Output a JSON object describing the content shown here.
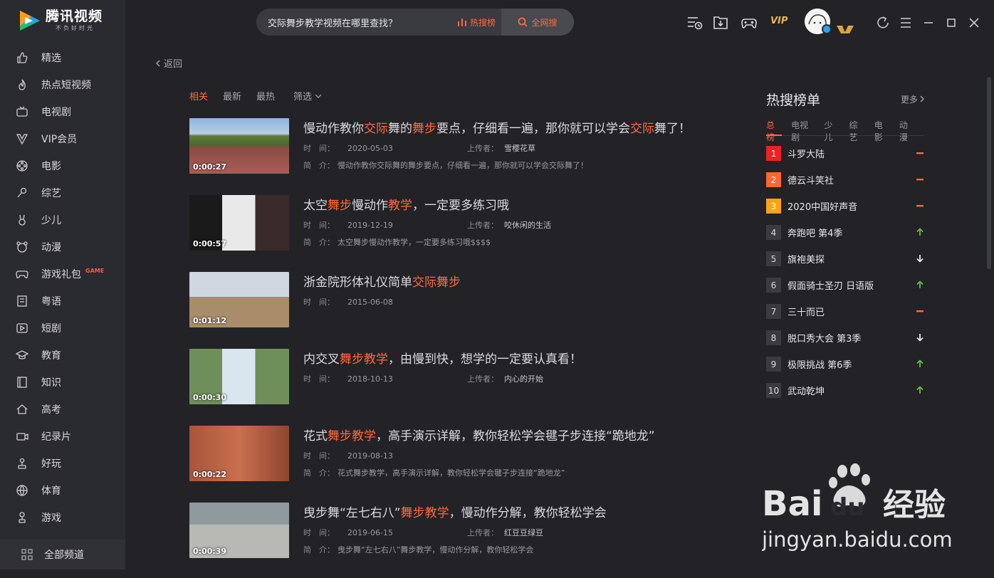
{
  "app": {
    "title": "腾讯视频",
    "slogan": "不负好时光"
  },
  "sidebar": {
    "items": [
      {
        "label": "精选",
        "icon": "thumbs-up-icon"
      },
      {
        "label": "热点短视频",
        "icon": "flame-icon"
      },
      {
        "label": "电视剧",
        "icon": "tv-icon"
      },
      {
        "label": "VIP会员",
        "icon": "vip-crown-icon"
      },
      {
        "label": "电影",
        "icon": "film-reel-icon"
      },
      {
        "label": "综艺",
        "icon": "microphone-icon"
      },
      {
        "label": "少儿",
        "icon": "bunny-icon"
      },
      {
        "label": "动漫",
        "icon": "bear-icon"
      },
      {
        "label": "游戏礼包",
        "icon": "gamepad-icon",
        "badge": "GAME"
      },
      {
        "label": "粤语",
        "icon": "document-icon"
      },
      {
        "label": "短剧",
        "icon": "play-square-icon"
      },
      {
        "label": "教育",
        "icon": "graduation-cap-icon"
      },
      {
        "label": "知识",
        "icon": "book-icon"
      },
      {
        "label": "高考",
        "icon": "house-icon"
      },
      {
        "label": "纪录片",
        "icon": "camera-icon"
      },
      {
        "label": "好玩",
        "icon": "joystick-icon"
      },
      {
        "label": "体育",
        "icon": "basketball-icon"
      },
      {
        "label": "游戏",
        "icon": "gamepad-stick-icon"
      }
    ],
    "all_channels": "全部频道"
  },
  "search": {
    "value": "交际舞步教学视频在哪里查找？",
    "hot_label": "热搜榜",
    "web_label": "全网搜"
  },
  "topbar": {
    "vip": "VIP"
  },
  "nav": {
    "back": "返回"
  },
  "tabs": [
    "相关",
    "最新",
    "最热"
  ],
  "filter_label": "筛选",
  "labels": {
    "time": "时　间：",
    "uploader": "上传者：",
    "intro": "简　介："
  },
  "results": [
    {
      "title_parts": [
        {
          "t": "慢动作教你",
          "h": false
        },
        {
          "t": "交际",
          "h": true
        },
        {
          "t": "舞的",
          "h": false
        },
        {
          "t": "舞步",
          "h": true
        },
        {
          "t": "要点，仔细看一遍，那你就可以学会",
          "h": false
        },
        {
          "t": "交际",
          "h": true
        },
        {
          "t": "舞了！",
          "h": false
        }
      ],
      "duration": "0:00:27",
      "date": "2020-05-03",
      "uploader": "雪樱花草",
      "intro": "慢动作教你交际舞的舞步要点，仔细看一遍，那你就可以学会交际舞了！"
    },
    {
      "title_parts": [
        {
          "t": "太空",
          "h": false
        },
        {
          "t": "舞步",
          "h": true
        },
        {
          "t": "慢动作",
          "h": false
        },
        {
          "t": "教学",
          "h": true
        },
        {
          "t": "，一定要多练习哦",
          "h": false
        }
      ],
      "duration": "0:00:57",
      "date": "2019-12-19",
      "uploader": "咬休闲的生活",
      "intro": "太空舞步慢动作教学，一定要多练习哦$$$$"
    },
    {
      "title_parts": [
        {
          "t": "浙金院形体礼仪简单",
          "h": false
        },
        {
          "t": "交际舞步",
          "h": true
        }
      ],
      "duration": "0:01:12",
      "date": "2015-06-08",
      "uploader": "",
      "intro": ""
    },
    {
      "title_parts": [
        {
          "t": "内交叉",
          "h": false
        },
        {
          "t": "舞步教学",
          "h": true
        },
        {
          "t": "，由慢到快，想学的一定要认真看！",
          "h": false
        }
      ],
      "duration": "0:00:30",
      "date": "2018-10-13",
      "uploader": "内心的开始",
      "intro": ""
    },
    {
      "title_parts": [
        {
          "t": "花式",
          "h": false
        },
        {
          "t": "舞步教学",
          "h": true
        },
        {
          "t": "，高手演示详解，教你轻松学会毽子步连接“跪地龙”",
          "h": false
        }
      ],
      "duration": "0:00:22",
      "date": "2019-08-13",
      "uploader": "",
      "intro": "花式舞步教学，高手演示详解，教你轻松学会毽子步连接“跪地龙”"
    },
    {
      "title_parts": [
        {
          "t": "曳步舞“左七右八”",
          "h": false
        },
        {
          "t": "舞步教学",
          "h": true
        },
        {
          "t": "，慢动作分解，教你轻松学会",
          "h": false
        }
      ],
      "duration": "0:00:39",
      "date": "2019-06-15",
      "uploader": "红豆豆绿豆",
      "intro": "曳步舞“左七右八”舞步教学，慢动作分解，教你轻松学会"
    }
  ],
  "hot": {
    "title": "热搜榜单",
    "more": "更多",
    "tabs": [
      "总榜",
      "电视剧",
      "少儿",
      "综艺",
      "电影",
      "动漫"
    ],
    "items": [
      {
        "rank": "1",
        "name": "斗罗大陆",
        "trend": "flat",
        "color": "#ee2222"
      },
      {
        "rank": "2",
        "name": "德云斗笑社",
        "trend": "flat",
        "color": "#ff6633"
      },
      {
        "rank": "3",
        "name": "2020中国好声音",
        "trend": "flat",
        "color": "#ffa21a"
      },
      {
        "rank": "4",
        "name": "奔跑吧 第4季",
        "trend": "up",
        "color": ""
      },
      {
        "rank": "5",
        "name": "旗袍美探",
        "trend": "down",
        "color": ""
      },
      {
        "rank": "6",
        "name": "假面骑士圣刃 日语版",
        "trend": "up",
        "color": ""
      },
      {
        "rank": "7",
        "name": "三十而已",
        "trend": "flat",
        "color": ""
      },
      {
        "rank": "8",
        "name": "脱口秀大会 第3季",
        "trend": "down",
        "color": ""
      },
      {
        "rank": "9",
        "name": "极限挑战 第6季",
        "trend": "up",
        "color": ""
      },
      {
        "rank": "10",
        "name": "武动乾坤",
        "trend": "up",
        "color": ""
      }
    ]
  },
  "watermark": {
    "brand": "Baidu经验",
    "url": "jingyan.baidu.com"
  },
  "colors": {
    "accent": "#ff6a3c",
    "bg": "#222227",
    "sidebar": "#2a2a31",
    "up": "#5dc33b",
    "flat": "#ff6a3c",
    "down": "#e6e6e6"
  }
}
